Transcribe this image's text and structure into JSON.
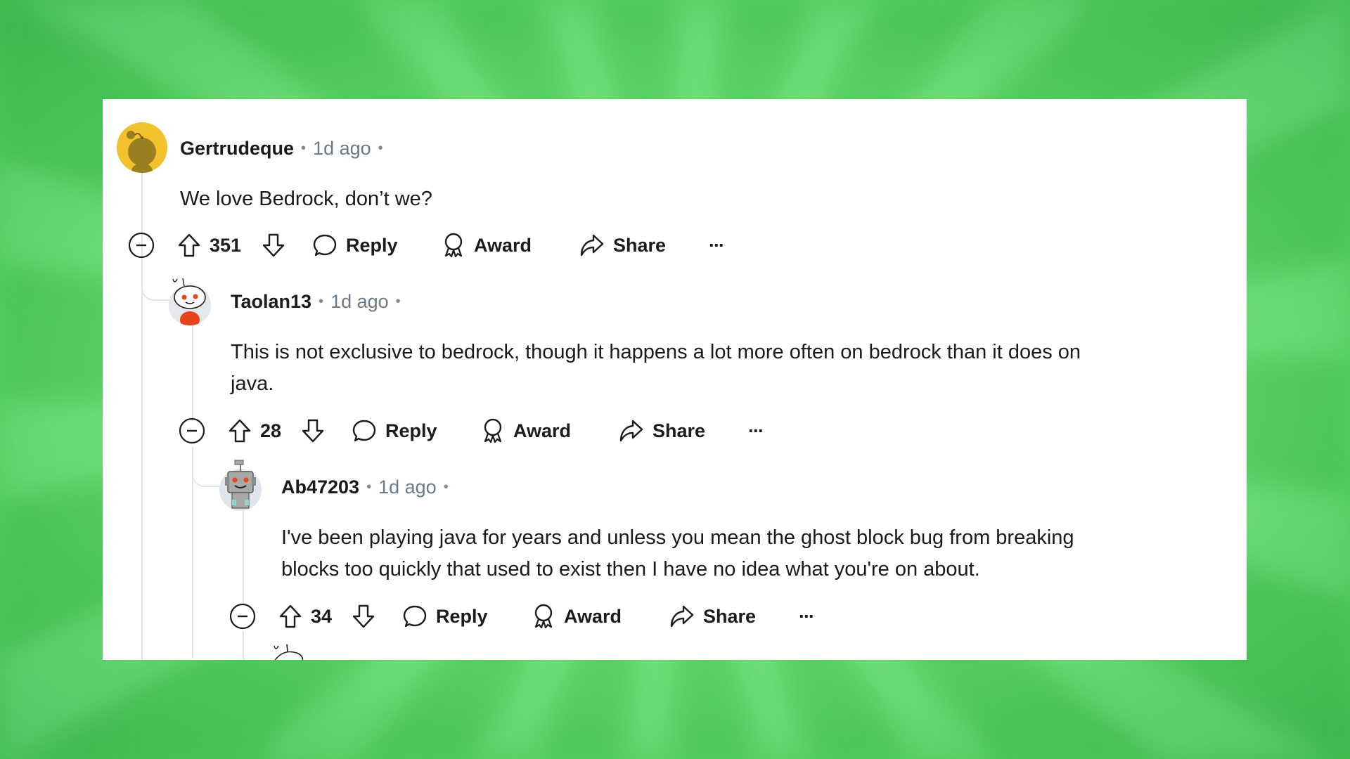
{
  "comments": [
    {
      "username": "Gertrudeque",
      "separator": "•",
      "time": "1d ago",
      "trailing_separator": "•",
      "avatar": "snoo-yellow-avatar",
      "avatar_color": "#f2c12e",
      "body_lines": [
        "We love Bedrock, don’t we?"
      ],
      "score": "351",
      "actions": {
        "reply": "Reply",
        "award": "Award",
        "share": "Share",
        "more": "···"
      }
    },
    {
      "username": "Taolan13",
      "separator": "•",
      "time": "1d ago",
      "trailing_separator": "•",
      "avatar": "snoo-orange-hoodie-avatar",
      "avatar_color": "#e8431b",
      "body_lines": [
        "This is not exclusive to bedrock, though it happens a lot more often on bedrock than it does on",
        "java."
      ],
      "score": "28",
      "actions": {
        "reply": "Reply",
        "award": "Award",
        "share": "Share",
        "more": "···"
      }
    },
    {
      "username": "Ab47203",
      "separator": "•",
      "time": "1d ago",
      "trailing_separator": "•",
      "avatar": "snoo-robot-avatar",
      "avatar_color": "#9a9a9a",
      "body_lines": [
        "I've been playing java for years and unless you mean the ghost block bug from breaking",
        "blocks too quickly that used to exist then I have no idea what you're on about."
      ],
      "score": "34",
      "actions": {
        "reply": "Reply",
        "award": "Award",
        "share": "Share",
        "more": "···"
      }
    }
  ],
  "colors": {
    "background": "#6ee675",
    "card": "#ffffff",
    "text": "#1a1a1b",
    "meta": "#6b7a87",
    "thread": "#e2e5e8"
  }
}
